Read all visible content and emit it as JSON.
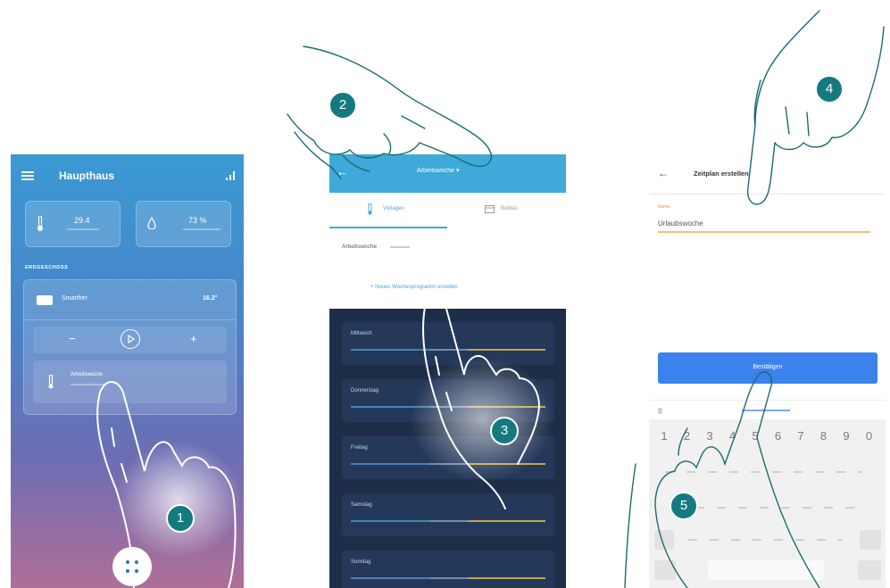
{
  "phone1": {
    "title": "Haupthaus",
    "temp_value": "29.4",
    "humidity_value": "73 %",
    "section_label": "ERDGESCHOSS",
    "room_name": "Smarther",
    "room_temp": "16.2°",
    "minus": "−",
    "plus": "+",
    "program_name": "Arbeitswoche"
  },
  "phone2": {
    "header_title": "Arbeitswoche ▾",
    "tab_program": "Vorlagen",
    "tab_holiday": "Boblau",
    "program_label": "Arbeitswoche",
    "create_button": "+  Neues Wochenprogramm erstellen",
    "days": [
      "Mittwoch",
      "Donnerstag",
      "Freitag",
      "Samstag",
      "Sonntag"
    ]
  },
  "phone3": {
    "back": "←",
    "title": "Zeitplan erstellen",
    "field_label": "Name",
    "field_value": "Urlaubswoche",
    "confirm_button": "Bestätigen",
    "number_row": [
      "1",
      "2",
      "3",
      "4",
      "5",
      "6",
      "7",
      "8",
      "9",
      "0"
    ]
  },
  "steps": [
    "1",
    "2",
    "3",
    "4",
    "5"
  ]
}
